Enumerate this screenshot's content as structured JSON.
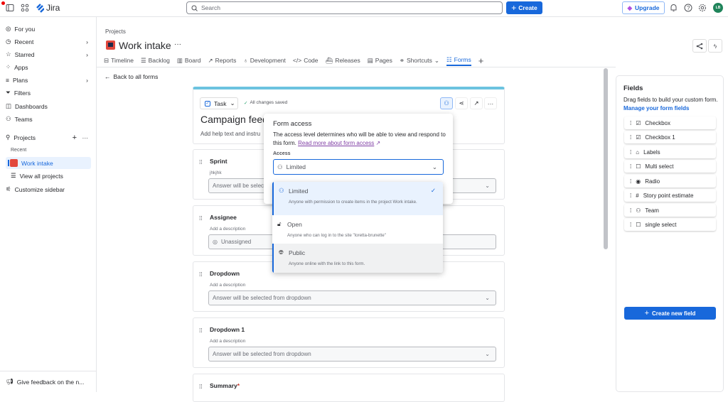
{
  "topbar": {
    "app_name": "Jira",
    "search_placeholder": "Search",
    "create_label": "Create",
    "upgrade_label": "Upgrade",
    "avatar_initials": "LB"
  },
  "sidebar": {
    "items": [
      {
        "label": "For you"
      },
      {
        "label": "Recent"
      },
      {
        "label": "Starred"
      },
      {
        "label": "Apps"
      },
      {
        "label": "Plans"
      },
      {
        "label": "Filters"
      },
      {
        "label": "Dashboards"
      },
      {
        "label": "Teams"
      }
    ],
    "projects_label": "Projects",
    "recent_label": "Recent",
    "work_intake": "Work intake",
    "view_all": "View all projects",
    "customize": "Customize sidebar",
    "feedback": "Give feedback on the n..."
  },
  "header": {
    "breadcrumb": "Projects",
    "title": "Work intake",
    "more": "···"
  },
  "tabs": [
    {
      "label": "Timeline"
    },
    {
      "label": "Backlog"
    },
    {
      "label": "Board"
    },
    {
      "label": "Reports"
    },
    {
      "label": "Development"
    },
    {
      "label": "Code"
    },
    {
      "label": "Releases"
    },
    {
      "label": "Pages"
    },
    {
      "label": "Shortcuts"
    },
    {
      "label": "Forms"
    }
  ],
  "back_link": "Back to all forms",
  "form": {
    "type_label": "Task",
    "saved_status": "All changes saved",
    "title": "Campaign feed",
    "help_text": "Add help text and instru",
    "fields": [
      {
        "label": "Sprint",
        "desc": "jhkjhk",
        "input": "Answer will be selec"
      },
      {
        "label": "Assignee",
        "desc": "Add a description",
        "input": "Unassigned"
      },
      {
        "label": "Dropdown",
        "desc": "Add a description",
        "input": "Answer will be selected from dropdown"
      },
      {
        "label": "Dropdown 1",
        "desc": "Add a description",
        "input": "Answer will be selected from dropdown"
      },
      {
        "label": "Summary",
        "required": "*"
      }
    ]
  },
  "access_popup": {
    "title": "Form access",
    "desc": "The access level determines who will be able to view and respond to this form.",
    "link": "Read more about form access",
    "access_label": "Access",
    "selected": "Limited",
    "options": [
      {
        "label": "Limited",
        "desc": "Anyone with permission to create items in the project Work intake."
      },
      {
        "label": "Open",
        "desc": "Anyone who can log in to the site \"loretta-brunette\""
      },
      {
        "label": "Public",
        "desc": "Anyone online with the link to this form."
      }
    ]
  },
  "fields_panel": {
    "title": "Fields",
    "desc": "Drag fields to build your custom form.",
    "link": "Manage your form fields",
    "items": [
      {
        "label": "Checkbox",
        "icon": "checkbox"
      },
      {
        "label": "Checkbox 1",
        "icon": "checkbox"
      },
      {
        "label": "Labels",
        "icon": "tag"
      },
      {
        "label": "Multi select",
        "icon": "square"
      },
      {
        "label": "Radio",
        "icon": "radio"
      },
      {
        "label": "Story point estimate",
        "icon": "hash"
      },
      {
        "label": "Team",
        "icon": "team"
      },
      {
        "label": "single select",
        "icon": "square"
      }
    ],
    "create_label": "Create new field"
  },
  "colors": {
    "brand": "#1868db",
    "accent_bar": "#6cc3e0",
    "avatar": "#1f845a",
    "link_visited": "#803fa5"
  }
}
